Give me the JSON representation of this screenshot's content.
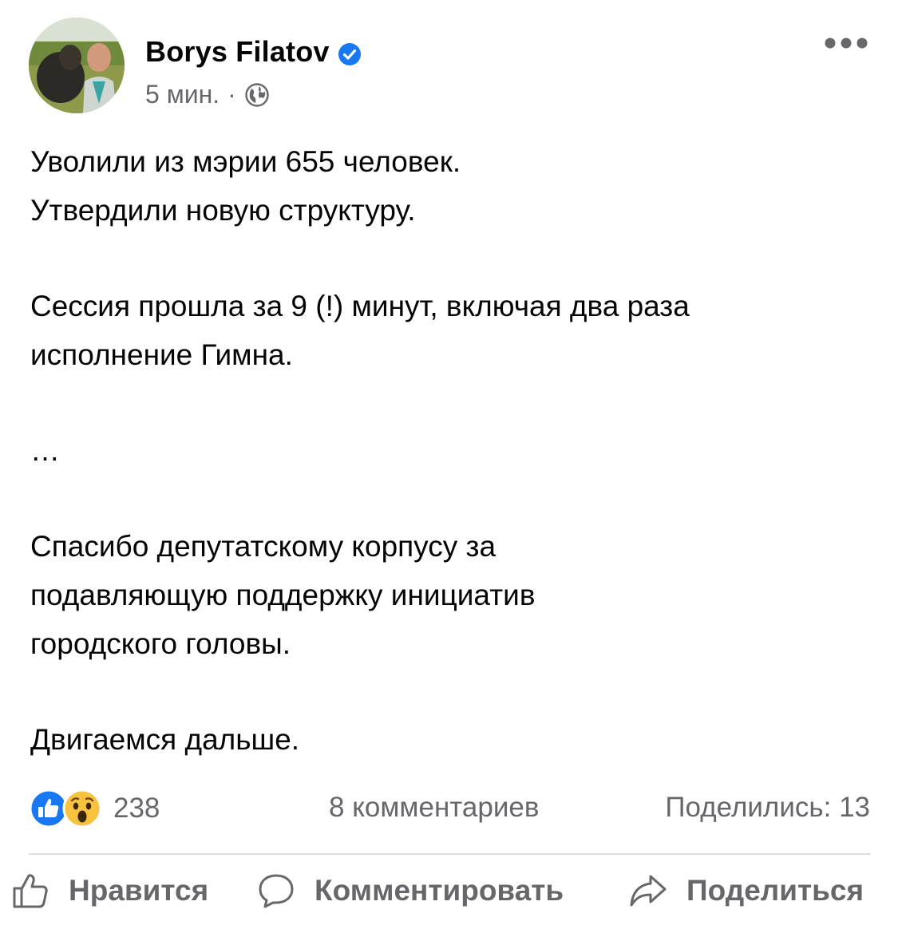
{
  "post": {
    "author": "Borys Filatov",
    "time": "5 мин.",
    "separator": "·",
    "body": {
      "p1_line1": "Уволили из мэрии 655 человек.",
      "p1_line2": "Утвердили новую структуру.",
      "p2_line1": "Сессия прошла за 9 (!) минут, включая два раза",
      "p2_line2": "исполнение Гимна.",
      "p3": "…",
      "p4_line1": "Спасибо депутатскому корпусу за",
      "p4_line2": "подавляющую поддержку инициатив",
      "p4_line3": "городского головы.",
      "p5": "Двигаемся дальше."
    }
  },
  "stats": {
    "reactions_count": "238",
    "comments": "8 комментариев",
    "shares": "Поделились: 13"
  },
  "actions": {
    "like": "Нравится",
    "comment": "Комментировать",
    "share": "Поделиться"
  },
  "colors": {
    "brand_blue": "#1877f2",
    "secondary_text": "#65676b",
    "divider": "#dadde1"
  },
  "icons": {
    "verified": "verified-badge-icon",
    "audience": "globe-icon",
    "menu": "more-options-icon",
    "like": "thumbs-up-icon",
    "comment": "comment-bubble-icon",
    "share": "share-arrow-icon"
  }
}
